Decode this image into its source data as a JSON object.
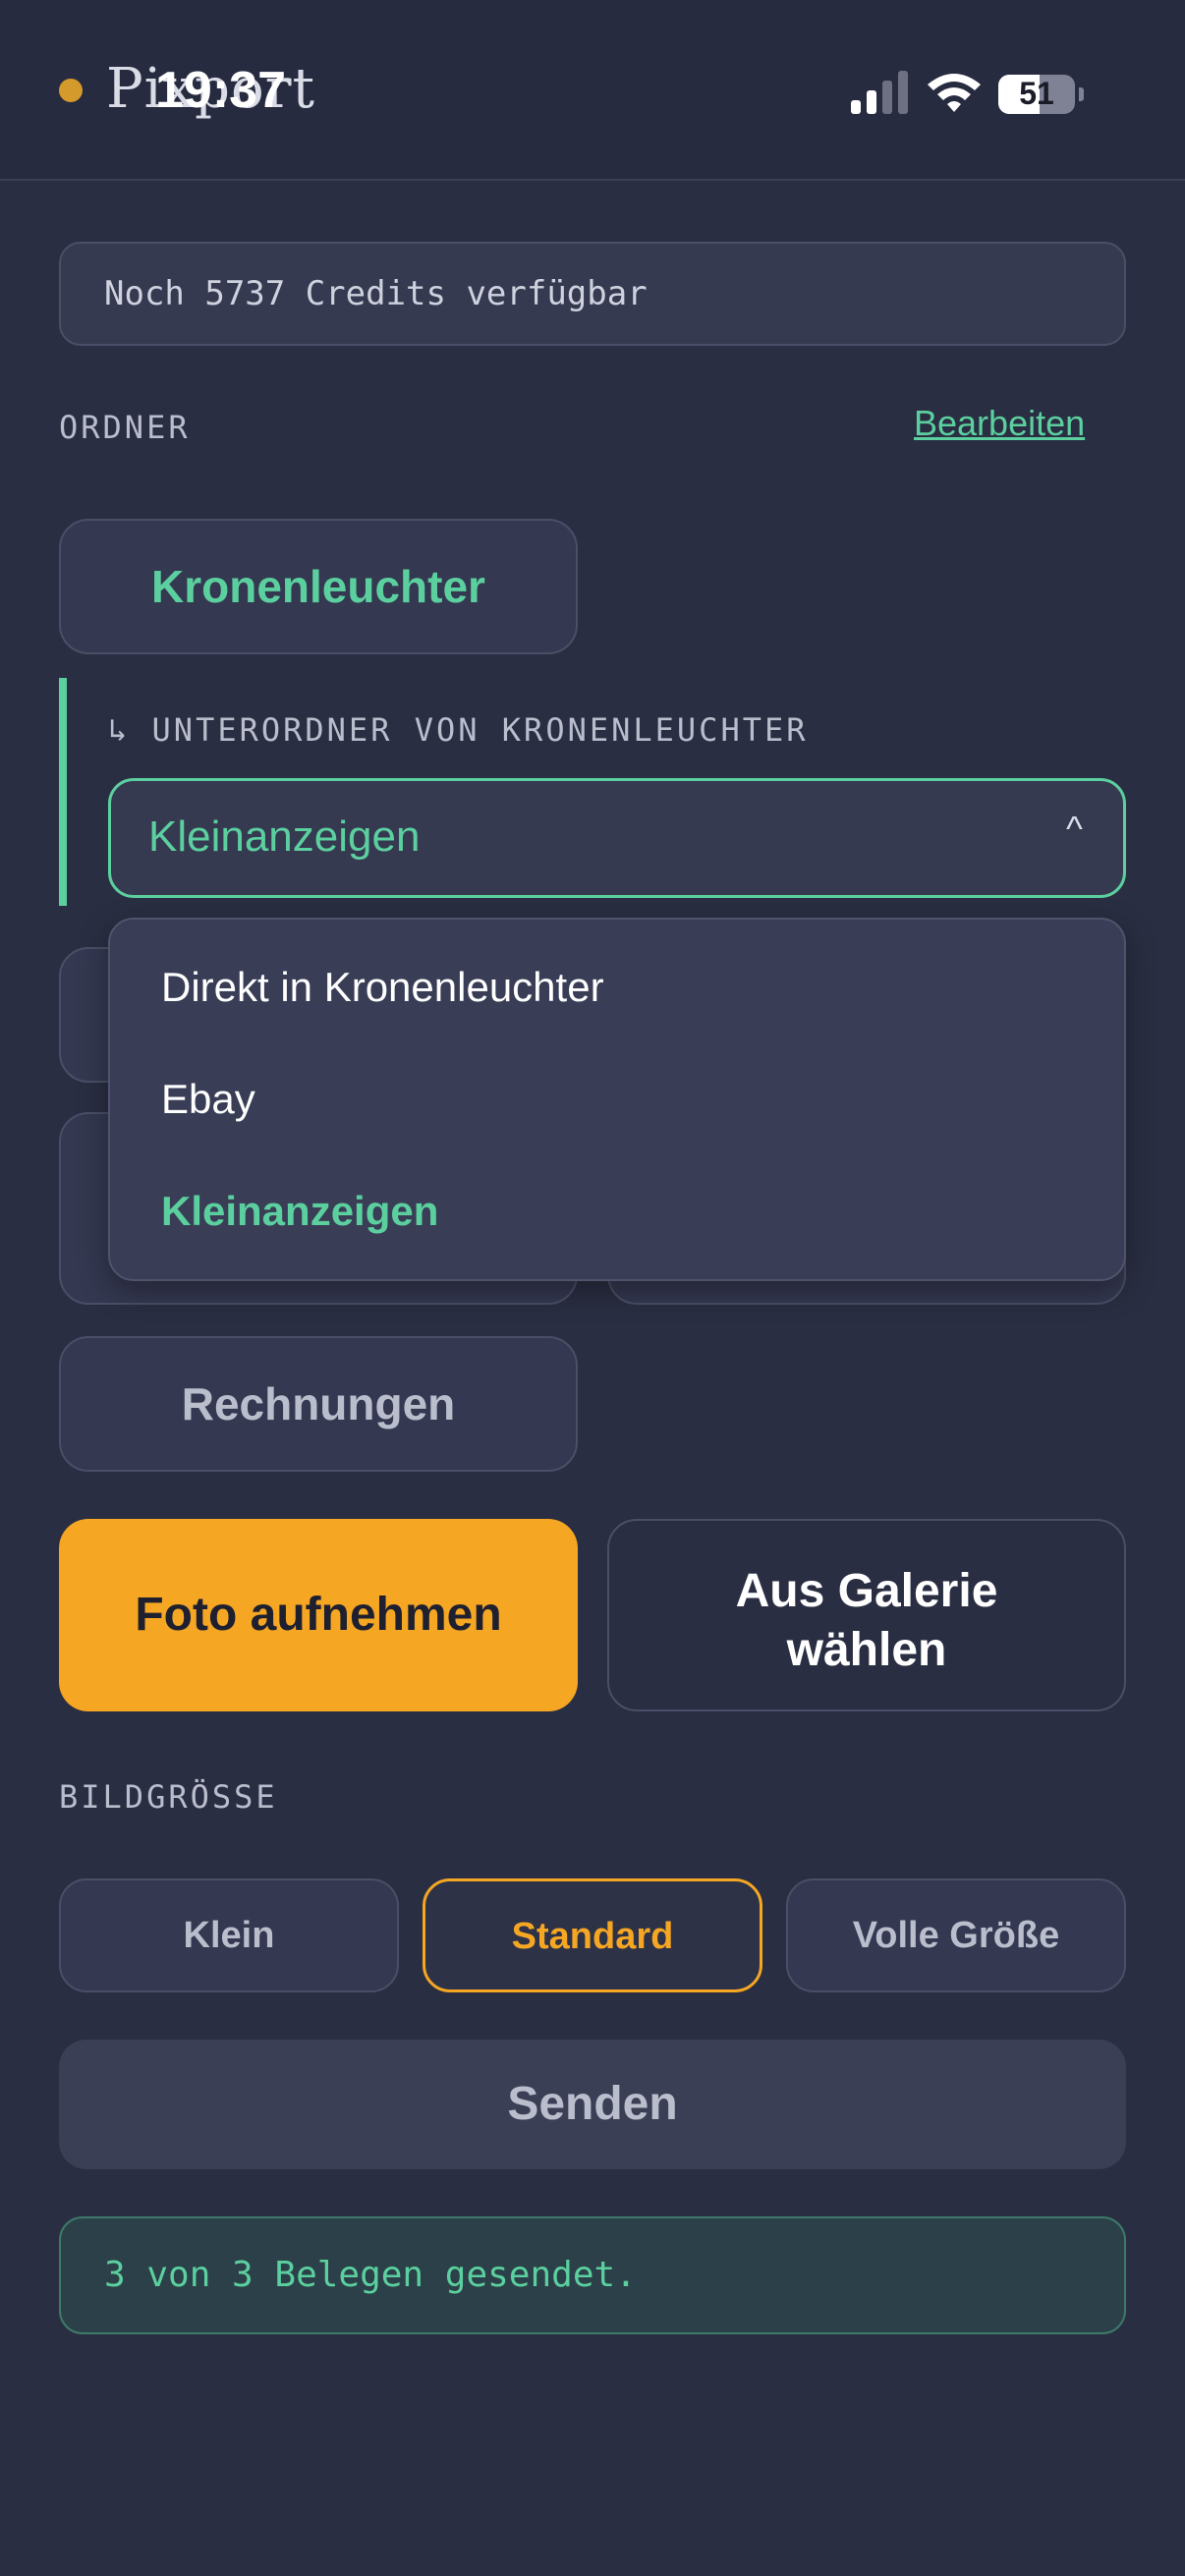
{
  "app": {
    "brand": "Pixport"
  },
  "status_bar": {
    "time": "19:37",
    "battery": "51",
    "icons": [
      "cellular-signal-icon",
      "wifi-icon",
      "battery-icon"
    ]
  },
  "credits": {
    "text": "Noch 5737 Credits verfügbar"
  },
  "folders": {
    "section_label": "ORDNER",
    "edit_label": "Bearbeiten",
    "items": [
      {
        "label": "Kronenleuchter",
        "active": true
      },
      {
        "label": "Rechnungen",
        "active": false
      }
    ]
  },
  "subfolder": {
    "label": "↳ UNTERORDNER VON KRONENLEUCHTER",
    "selected": "Kleinanzeigen",
    "caret": "^",
    "options": [
      {
        "label": "Direkt in Kronenleuchter",
        "selected": false
      },
      {
        "label": "Ebay",
        "selected": false
      },
      {
        "label": "Kleinanzeigen",
        "selected": true
      }
    ]
  },
  "actions": {
    "take_photo": "Foto aufnehmen",
    "gallery_line1": "Aus Galerie",
    "gallery_line2": "wählen"
  },
  "image_size": {
    "section_label": "BILDGRÖSSE",
    "options": [
      {
        "label": "Klein",
        "active": false
      },
      {
        "label": "Standard",
        "active": true
      },
      {
        "label": "Volle Größe",
        "active": false
      }
    ]
  },
  "send": {
    "label": "Senden"
  },
  "status": {
    "text": "3 von 3 Belegen gesendet."
  },
  "colors": {
    "accent_green": "#5ccf9f",
    "accent_orange": "#f5a623",
    "background": "#2a2e42"
  }
}
